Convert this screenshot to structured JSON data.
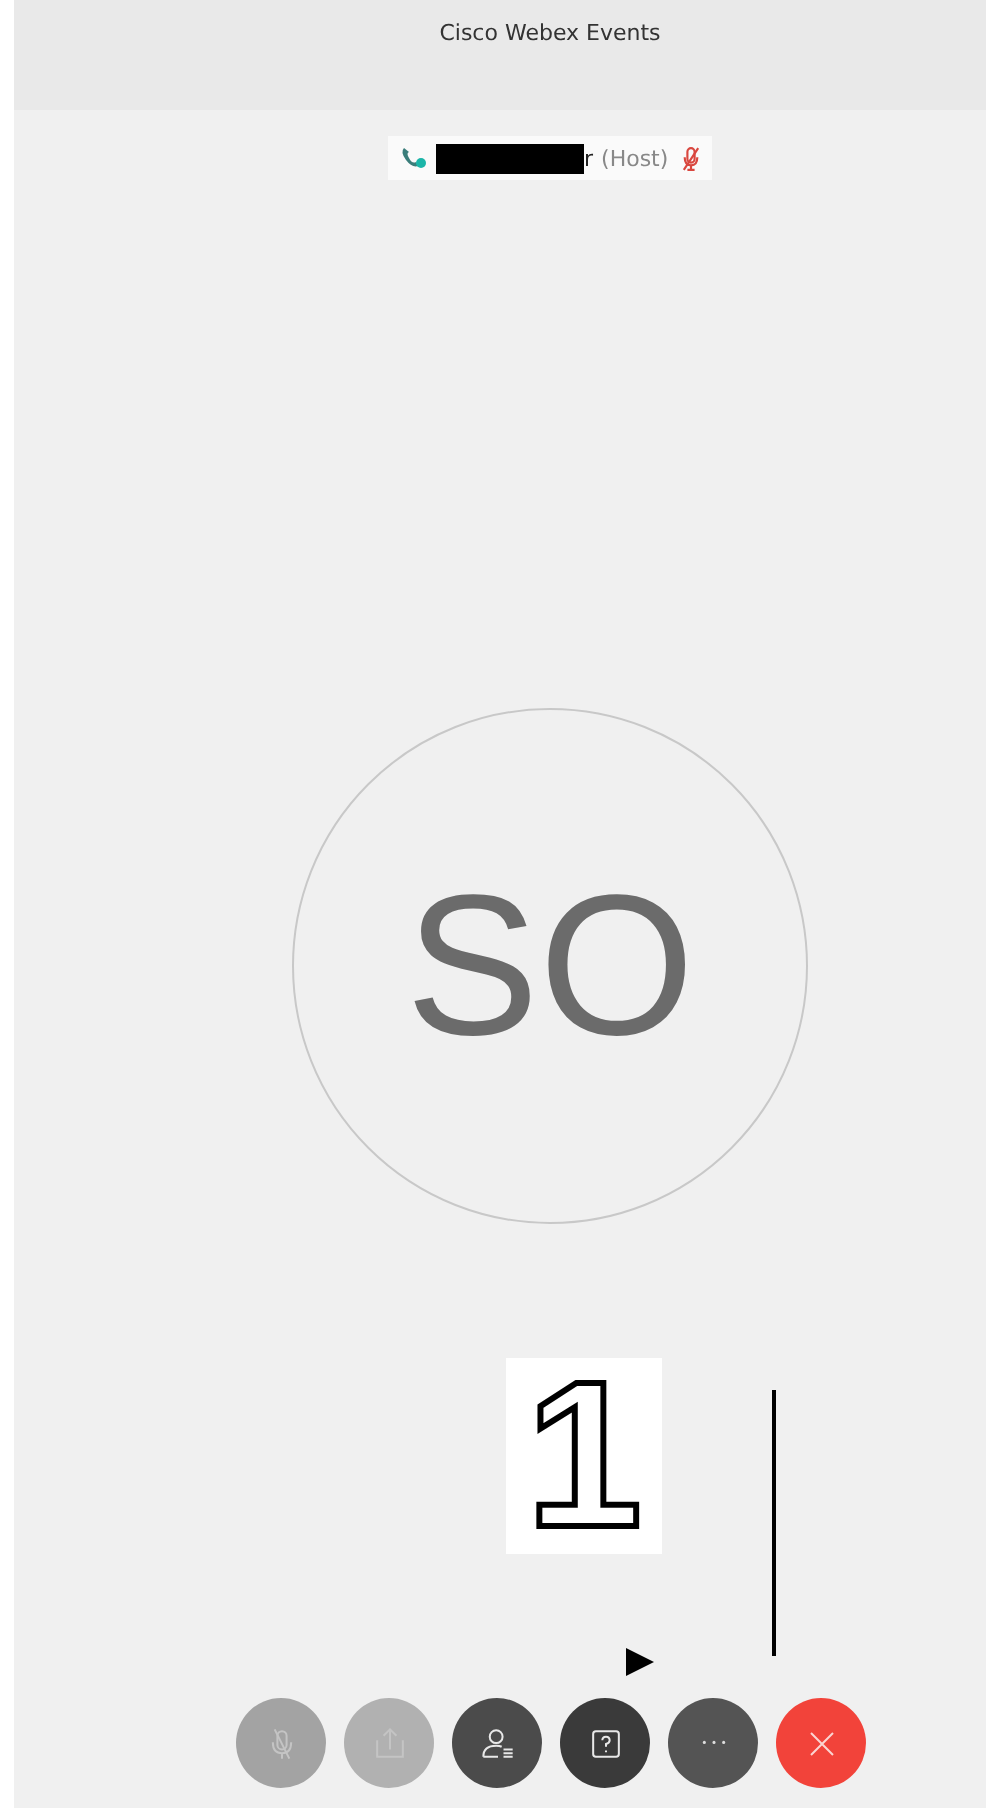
{
  "window": {
    "title": "Cisco Webex Events"
  },
  "speaker": {
    "name": "r",
    "role": "(Host)",
    "muted": true,
    "redacted": true
  },
  "avatar": {
    "initials": "SO"
  },
  "annotation": {
    "label": "1"
  },
  "controls": [
    {
      "kind": "mic",
      "disabled": true
    },
    {
      "kind": "share",
      "disabled": true
    },
    {
      "kind": "participants",
      "disabled": false
    },
    {
      "kind": "qa",
      "disabled": false
    },
    {
      "kind": "more",
      "disabled": false
    },
    {
      "kind": "leave",
      "disabled": false
    }
  ]
}
